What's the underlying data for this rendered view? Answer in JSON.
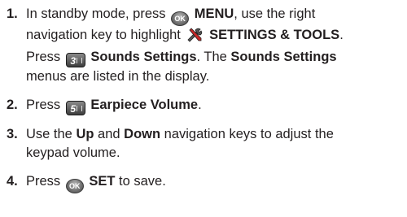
{
  "steps": [
    {
      "number": "1.",
      "line1_pre": "In standby mode, press ",
      "key_ok": "OK",
      "menu": "MENU",
      "line1_post": ", use the right",
      "line2_pre": "navigation key to highlight ",
      "tools_icon": "settings-tools-icon",
      "settings_tools": "SETTINGS & TOOLS",
      "line2_post": ".",
      "line3_pre": "Press ",
      "key3": "3",
      "sounds_settings": "Sounds Settings",
      "line3_post": ". The ",
      "sounds_settings_2": "Sounds Settings",
      "line4": "menus are listed in the display."
    },
    {
      "number": "2.",
      "pre": "Press ",
      "key5": "5",
      "earpiece": "Earpiece Volume",
      "post": "."
    },
    {
      "number": "3.",
      "pre": "Use the ",
      "up": "Up",
      "mid": " and ",
      "down": "Down",
      "post1": " navigation keys to adjust the",
      "line2": "keypad volume."
    },
    {
      "number": "4.",
      "pre": "Press ",
      "key_ok": "OK",
      "set": "SET",
      "post": " to save."
    }
  ]
}
